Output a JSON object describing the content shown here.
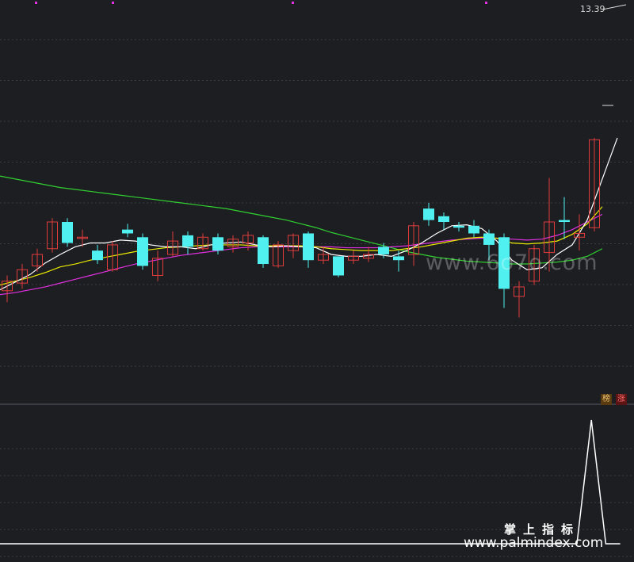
{
  "chart_data": {
    "type": "candlestick",
    "price_label": "13.39",
    "panels": {
      "sub_indicator_tags": [
        "榜",
        "涨"
      ]
    },
    "colors": {
      "background": "#1d1e22",
      "up": "#e03c3c",
      "down": "#4ff0ef",
      "ma5": "#ffffff",
      "ma10": "#e8e800",
      "ma20": "#e030e0",
      "ma60": "#30d030",
      "indicator": "#ffffff",
      "grid": "#3a3c44"
    },
    "candles": [
      {
        "o": 10.38,
        "c": 10.48,
        "h": 10.54,
        "l": 10.26
      },
      {
        "o": 10.46,
        "c": 10.6,
        "h": 10.66,
        "l": 10.4
      },
      {
        "o": 10.64,
        "c": 10.76,
        "h": 10.82,
        "l": 10.58
      },
      {
        "o": 10.82,
        "c": 11.1,
        "h": 11.14,
        "l": 10.78
      },
      {
        "o": 11.1,
        "c": 10.88,
        "h": 11.14,
        "l": 10.84
      },
      {
        "o": 10.94,
        "c": 10.94,
        "h": 11.02,
        "l": 10.84
      },
      {
        "o": 10.8,
        "c": 10.7,
        "h": 10.86,
        "l": 10.66
      },
      {
        "o": 10.6,
        "c": 10.86,
        "h": 10.9,
        "l": 10.58
      },
      {
        "o": 11.02,
        "c": 10.98,
        "h": 11.08,
        "l": 10.94
      },
      {
        "o": 10.94,
        "c": 10.64,
        "h": 10.98,
        "l": 10.6
      },
      {
        "o": 10.54,
        "c": 10.72,
        "h": 10.8,
        "l": 10.48
      },
      {
        "o": 10.76,
        "c": 10.9,
        "h": 11.0,
        "l": 10.74
      },
      {
        "o": 10.96,
        "c": 10.84,
        "h": 11.0,
        "l": 10.76
      },
      {
        "o": 10.82,
        "c": 10.94,
        "h": 10.98,
        "l": 10.8
      },
      {
        "o": 10.94,
        "c": 10.8,
        "h": 10.98,
        "l": 10.76
      },
      {
        "o": 10.84,
        "c": 10.92,
        "h": 10.96,
        "l": 10.78
      },
      {
        "o": 10.88,
        "c": 10.96,
        "h": 11.0,
        "l": 10.8
      },
      {
        "o": 10.94,
        "c": 10.66,
        "h": 10.96,
        "l": 10.62
      },
      {
        "o": 10.64,
        "c": 10.86,
        "h": 10.9,
        "l": 10.62
      },
      {
        "o": 10.8,
        "c": 10.96,
        "h": 10.98,
        "l": 10.72
      },
      {
        "o": 10.98,
        "c": 10.7,
        "h": 11.0,
        "l": 10.62
      },
      {
        "o": 10.7,
        "c": 10.76,
        "h": 10.84,
        "l": 10.66
      },
      {
        "o": 10.74,
        "c": 10.54,
        "h": 10.74,
        "l": 10.52
      },
      {
        "o": 10.7,
        "c": 10.74,
        "h": 10.8,
        "l": 10.66
      },
      {
        "o": 10.72,
        "c": 10.76,
        "h": 10.84,
        "l": 10.68
      },
      {
        "o": 10.84,
        "c": 10.76,
        "h": 10.88,
        "l": 10.72
      },
      {
        "o": 10.74,
        "c": 10.7,
        "h": 10.8,
        "l": 10.58
      },
      {
        "o": 10.76,
        "c": 11.06,
        "h": 11.1,
        "l": 10.64
      },
      {
        "o": 11.24,
        "c": 11.12,
        "h": 11.3,
        "l": 11.06
      },
      {
        "o": 11.16,
        "c": 11.1,
        "h": 11.2,
        "l": 11.02
      },
      {
        "o": 11.06,
        "c": 11.04,
        "h": 11.1,
        "l": 11.0
      },
      {
        "o": 11.06,
        "c": 10.98,
        "h": 11.12,
        "l": 10.94
      },
      {
        "o": 10.98,
        "c": 10.86,
        "h": 11.02,
        "l": 10.7
      },
      {
        "o": 10.94,
        "c": 10.4,
        "h": 10.98,
        "l": 10.2
      },
      {
        "o": 10.32,
        "c": 10.42,
        "h": 10.48,
        "l": 10.1
      },
      {
        "o": 10.48,
        "c": 10.82,
        "h": 10.86,
        "l": 10.44
      },
      {
        "o": 10.78,
        "c": 11.1,
        "h": 11.56,
        "l": 10.58
      },
      {
        "o": 11.12,
        "c": 11.1,
        "h": 11.36,
        "l": 10.92
      },
      {
        "o": 10.94,
        "c": 10.98,
        "h": 11.18,
        "l": 10.8
      },
      {
        "o": 11.04,
        "c": 11.96,
        "h": 11.98,
        "l": 11.0
      }
    ],
    "ma5": [
      10.39,
      10.47,
      10.55,
      10.67,
      10.76,
      10.84,
      10.88,
      10.88,
      10.91,
      10.9,
      10.86,
      10.84,
      10.84,
      10.82,
      10.86,
      10.88,
      10.89,
      10.86,
      10.84,
      10.85,
      10.84,
      10.83,
      10.76,
      10.74,
      10.74,
      10.76,
      10.74,
      10.8,
      10.88,
      10.98,
      11.06,
      11.07,
      11.03,
      10.9,
      10.7,
      10.6,
      10.62,
      10.76,
      10.86,
      11.12,
      11.55,
      11.98
    ],
    "ma10": [
      10.44,
      10.48,
      10.52,
      10.57,
      10.63,
      10.66,
      10.7,
      10.73,
      10.76,
      10.79,
      10.81,
      10.83,
      10.84,
      10.85,
      10.86,
      10.86,
      10.86,
      10.85,
      10.85,
      10.85,
      10.85,
      10.84,
      10.82,
      10.81,
      10.8,
      10.8,
      10.8,
      10.82,
      10.84,
      10.87,
      10.9,
      10.93,
      10.94,
      10.93,
      10.88,
      10.87,
      10.88,
      10.9,
      10.97,
      11.08,
      11.26
    ],
    "ma20": [
      10.34,
      10.36,
      10.39,
      10.42,
      10.46,
      10.5,
      10.54,
      10.58,
      10.62,
      10.66,
      10.69,
      10.72,
      10.75,
      10.77,
      10.79,
      10.81,
      10.83,
      10.84,
      10.84,
      10.84,
      10.84,
      10.84,
      10.84,
      10.83,
      10.83,
      10.83,
      10.84,
      10.85,
      10.87,
      10.89,
      10.91,
      10.92,
      10.93,
      10.93,
      10.92,
      10.91,
      10.92,
      10.96,
      11.02,
      11.1,
      11.18
    ],
    "ma60": [
      11.58,
      11.55,
      11.52,
      11.49,
      11.46,
      11.44,
      11.42,
      11.4,
      11.38,
      11.36,
      11.34,
      11.32,
      11.3,
      11.28,
      11.26,
      11.24,
      11.21,
      11.18,
      11.15,
      11.12,
      11.08,
      11.04,
      10.99,
      10.95,
      10.91,
      10.87,
      10.83,
      10.79,
      10.76,
      10.73,
      10.71,
      10.69,
      10.68,
      10.67,
      10.66,
      10.66,
      10.67,
      10.68,
      10.7,
      10.74,
      10.82
    ],
    "indicator": [
      0,
      0,
      0,
      0,
      0,
      0,
      0,
      0,
      0,
      0,
      0,
      0,
      0,
      0,
      0,
      0,
      0,
      0,
      0,
      0,
      0,
      0,
      0,
      0,
      0,
      0,
      0,
      0,
      0,
      0,
      0,
      0,
      0,
      0,
      0,
      0,
      0,
      0,
      0,
      0,
      0,
      1,
      0,
      0
    ]
  },
  "watermark": {
    "brand_cn": "掌上指标",
    "url": "www.palmindex.com",
    "mid_url": "www.6o7o.com"
  }
}
